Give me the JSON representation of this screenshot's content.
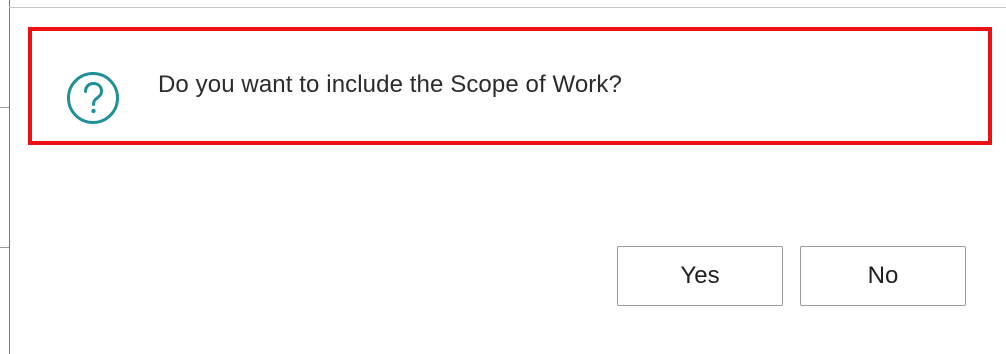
{
  "dialog": {
    "message": "Do you want to include the Scope of Work?",
    "icon": "question-circle-icon",
    "highlight_color": "#ee1111",
    "icon_color": "#1f8f98"
  },
  "buttons": {
    "yes_label": "Yes",
    "no_label": "No"
  }
}
